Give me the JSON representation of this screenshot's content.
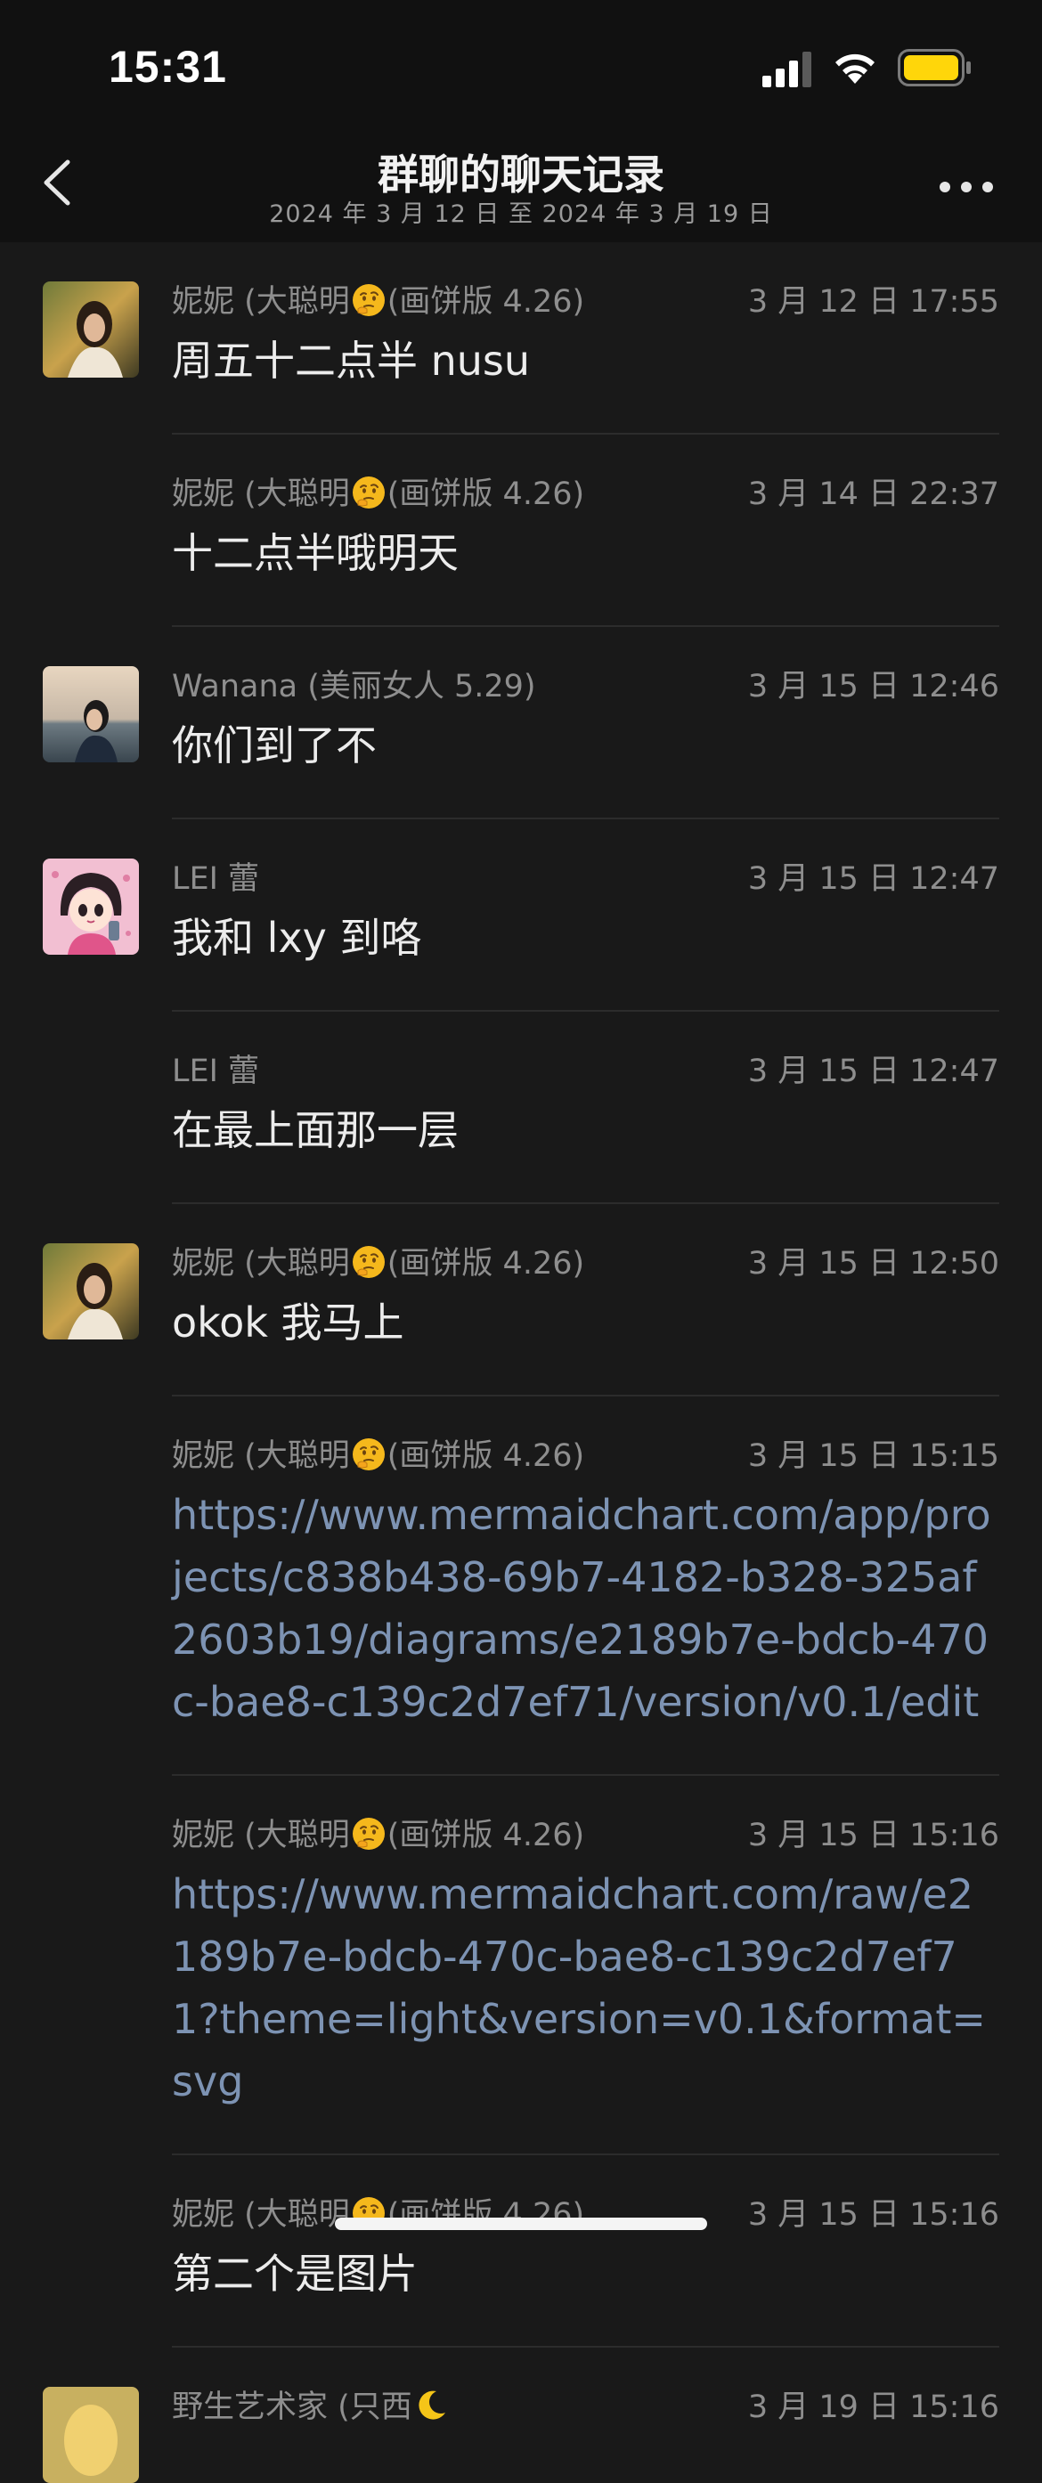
{
  "status_bar": {
    "time": "15:31"
  },
  "header": {
    "title": "群聊的聊天记录",
    "subtitle": "2024 年 3 月 12 日 至 2024 年 3 月 19 日"
  },
  "messages": [
    {
      "sender_prefix": "妮妮 (大聪明",
      "sender_emoji": "thinking-face",
      "sender_suffix": "(画饼版 4.26)",
      "time": "3 月 12 日 17:55",
      "text": "周五十二点半 nusu",
      "avatar": "woman-photo-1",
      "is_link": false
    },
    {
      "sender_prefix": "妮妮 (大聪明",
      "sender_emoji": "thinking-face",
      "sender_suffix": "(画饼版 4.26)",
      "time": "3 月 14 日 22:37",
      "text": "十二点半哦明天",
      "avatar": "",
      "is_link": false
    },
    {
      "sender_prefix": "Wanana (美丽女人 5.29)",
      "sender_emoji": "",
      "sender_suffix": "",
      "time": "3 月 15 日 12:46",
      "text": "你们到了不",
      "avatar": "woman-beach-photo",
      "is_link": false
    },
    {
      "sender_prefix": "LEI 蕾",
      "sender_emoji": "",
      "sender_suffix": "",
      "time": "3 月 15 日 12:47",
      "text": "我和 lxy 到咯",
      "avatar": "cartoon-girl",
      "is_link": false
    },
    {
      "sender_prefix": "LEI 蕾",
      "sender_emoji": "",
      "sender_suffix": "",
      "time": "3 月 15 日 12:47",
      "text": "在最上面那一层",
      "avatar": "",
      "is_link": false
    },
    {
      "sender_prefix": "妮妮 (大聪明",
      "sender_emoji": "thinking-face",
      "sender_suffix": "(画饼版 4.26)",
      "time": "3 月 15 日 12:50",
      "text": "okok 我马上",
      "avatar": "woman-photo-1",
      "is_link": false
    },
    {
      "sender_prefix": "妮妮 (大聪明",
      "sender_emoji": "thinking-face",
      "sender_suffix": "(画饼版 4.26)",
      "time": "3 月 15 日 15:15",
      "text": "https://www.mermaidchart.com/app/projects/c838b438-69b7-4182-b328-325af2603b19/diagrams/e2189b7e-bdcb-470c-bae8-c139c2d7ef71/version/v0.1/edit",
      "avatar": "",
      "is_link": true
    },
    {
      "sender_prefix": "妮妮 (大聪明",
      "sender_emoji": "thinking-face",
      "sender_suffix": "(画饼版 4.26)",
      "time": "3 月 15 日 15:16",
      "text": "https://www.mermaidchart.com/raw/e2189b7e-bdcb-470c-bae8-c139c2d7ef71?theme=light&version=v0.1&format=svg",
      "avatar": "",
      "is_link": true
    },
    {
      "sender_prefix": "妮妮 (大聪明",
      "sender_emoji": "thinking-face",
      "sender_suffix": "(画饼版 4.26)",
      "time": "3 月 15 日 15:16",
      "text": "第二个是图片",
      "avatar": "",
      "is_link": false
    },
    {
      "sender_prefix": "野生艺术家 (只西",
      "sender_emoji": "moon-face",
      "sender_suffix": "",
      "time": "3 月 19 日 15:16",
      "text": "",
      "avatar": "blonde-photo",
      "is_link": false
    }
  ]
}
